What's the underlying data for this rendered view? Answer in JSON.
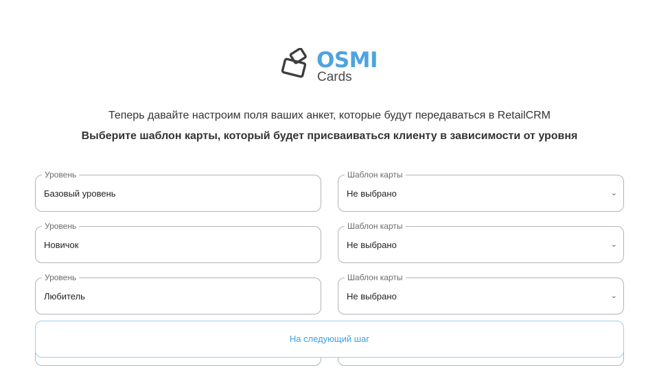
{
  "logo": {
    "title": "OSMI",
    "subtitle": "Cards",
    "icon": "cards-icon"
  },
  "intro": "Теперь давайте настроим поля ваших анкет, которые будут передаваться в RetailCRM",
  "subtitle": "Выберите шаблон карты, который будет присваиваться клиенту в зависимости от уровня",
  "rows": [
    {
      "level_label": "Уровень",
      "level_value": "Базовый уровень",
      "template_label": "Шаблон карты",
      "template_value": "Не выбрано"
    },
    {
      "level_label": "Уровень",
      "level_value": "Новичок",
      "template_label": "Шаблон карты",
      "template_value": "Не выбрано"
    },
    {
      "level_label": "Уровень",
      "level_value": "Любитель",
      "template_label": "Шаблон карты",
      "template_value": "Не выбрано"
    }
  ],
  "next_button": "На следующий шаг",
  "colors": {
    "accent": "#4fa3e0",
    "border": "#aeb4bb",
    "button_border": "#9ccdf0"
  }
}
